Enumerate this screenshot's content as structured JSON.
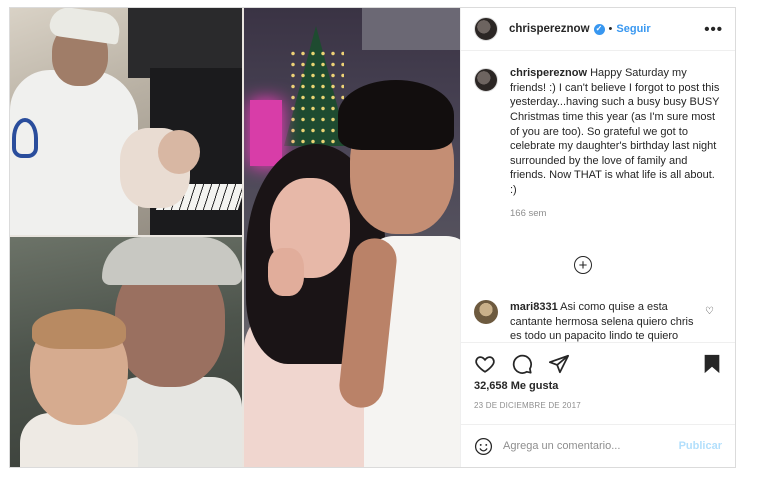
{
  "header": {
    "username": "chrispereznow",
    "separator": "•",
    "follow_label": "Seguir",
    "more_label": "•••"
  },
  "caption": {
    "username": "chrispereznow",
    "text": "Happy Saturday my friends! :) I can't believe I forgot to post this yesterday...having such a busy busy BUSY Christmas time this year (as I'm sure most of you are too). So grateful we got to celebrate my daughter's birthday last night surrounded by the love of family and friends. Now THAT is what life is all about. :)",
    "time": "166 sem"
  },
  "load_more_label": "+",
  "comment": {
    "username": "mari8331",
    "text": "Asi como quise a esta cantante hermosa selena quiero chris es todo un papacito lindo te quiero chris perez mucios",
    "like_icon": "♡"
  },
  "likes": {
    "count": "32,658",
    "label": "Me gusta"
  },
  "date": "23 DE DICIEMBRE DE 2017",
  "add_comment": {
    "placeholder": "Agrega un comentario...",
    "post_label": "Publicar"
  },
  "colors": {
    "accent": "#3897f0",
    "post_disabled": "#b2dffc",
    "muted": "#8e8e8e",
    "border": "#dbdbdb"
  },
  "icons": [
    "verified-badge-icon",
    "more-icon",
    "add-circle-icon",
    "heart-icon",
    "comment-icon",
    "share-icon",
    "bookmark-icon",
    "emoji-icon"
  ]
}
